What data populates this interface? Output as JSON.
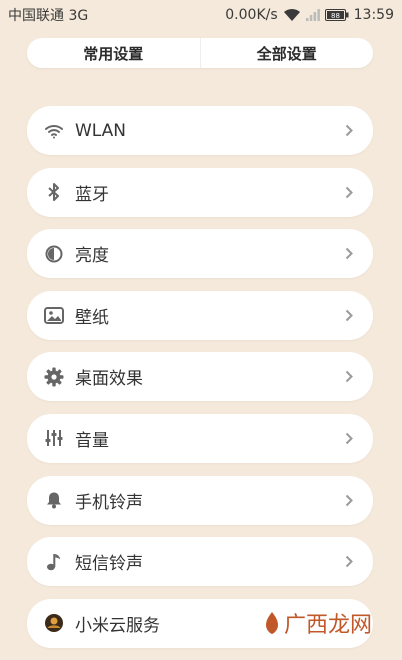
{
  "status_bar": {
    "carrier": "中国联通 3G",
    "speed": "0.00K/s",
    "time": "13:59",
    "battery_level": "88"
  },
  "tabs": [
    {
      "label": "常用设置"
    },
    {
      "label": "全部设置"
    }
  ],
  "items": [
    {
      "label": "WLAN",
      "icon": "wifi-icon"
    },
    {
      "label": "蓝牙",
      "icon": "bluetooth-icon"
    },
    {
      "label": "亮度",
      "icon": "brightness-icon"
    },
    {
      "label": "壁纸",
      "icon": "wallpaper-icon"
    },
    {
      "label": "桌面效果",
      "icon": "gear-icon"
    },
    {
      "label": "音量",
      "icon": "volume-sliders-icon"
    },
    {
      "label": "手机铃声",
      "icon": "bell-icon"
    },
    {
      "label": "短信铃声",
      "icon": "music-note-icon"
    },
    {
      "label": "小米云服务",
      "icon": "mi-cloud-icon"
    }
  ],
  "watermark": {
    "text": "广西龙网"
  },
  "colors": {
    "background": "#f4e9da",
    "card": "#ffffff",
    "icon": "#666666",
    "chevron": "#9a9a9a",
    "watermark": "#c0582a"
  }
}
